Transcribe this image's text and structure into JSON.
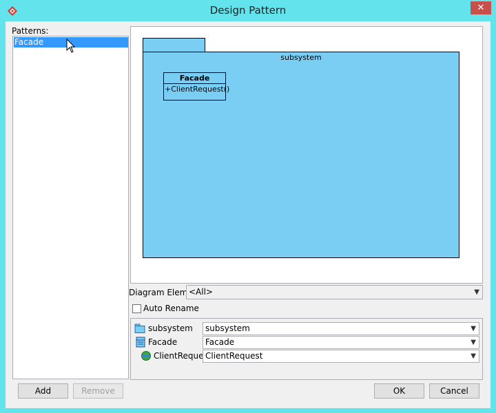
{
  "window": {
    "title": "Design Pattern",
    "close_label": "✕"
  },
  "patterns": {
    "label": "Patterns:",
    "items": [
      "Facade"
    ],
    "selected": "Facade"
  },
  "diagram": {
    "package_name": "subsystem",
    "class_name": "Facade",
    "operation": "+ClientRequest()",
    "package_color": "#7acef4"
  },
  "diagram_element": {
    "label": "Diagram Element",
    "value": "<All>"
  },
  "auto_rename": {
    "label": "Auto Rename",
    "checked": false
  },
  "properties": [
    {
      "name": "subsystem",
      "value": "subsystem",
      "icon": "package-icon"
    },
    {
      "name": "Facade",
      "value": "Facade",
      "icon": "class-icon"
    },
    {
      "name": "ClientRequest",
      "value": "ClientRequest",
      "icon": "operation-icon"
    }
  ],
  "buttons": {
    "add": "Add",
    "remove": "Remove",
    "ok": "OK",
    "cancel": "Cancel"
  },
  "colors": {
    "titlebar": "#63e3ec",
    "selection": "#3399ff",
    "close": "#c7504a"
  }
}
